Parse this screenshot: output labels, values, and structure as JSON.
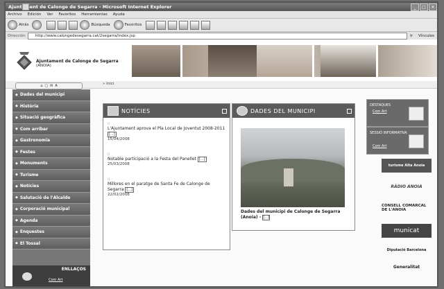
{
  "window": {
    "title": "Ajuntament de Calonge de Segarra - Microsoft Internet Explorer"
  },
  "menu": [
    "Archivo",
    "Edición",
    "Ver",
    "Favoritos",
    "Herramientas",
    "Ayuda"
  ],
  "toolbar": {
    "back": "Atrás",
    "search": "Búsqueda",
    "favorites": "Favoritos"
  },
  "address": {
    "label": "Dirección",
    "url": "http://www.calongedesegarra.cat/2segarra/index.jsp",
    "go": "Ir",
    "links": "Vínculos"
  },
  "site": {
    "name": "Ajuntament de Calonge de Segarra",
    "sub": "(ANOIA)"
  },
  "breadcrumb": "Inici",
  "sidebar": {
    "items": [
      "Dades del municipi",
      "Història",
      "Situació geogràfica",
      "Com arribar",
      "Gastronomia",
      "Festes",
      "Monuments",
      "Turisme",
      "Notícies",
      "Salutació de l'Alcalde",
      "Corporació municipal",
      "Agenda",
      "Enquestes",
      "El Tossal"
    ],
    "enllacos_title": "ENLLAÇOS",
    "enllacos_link": "Com Art"
  },
  "news": {
    "title": "NOTÍCIES",
    "items": [
      {
        "text": "L'Ajuntament aprova el Pla Local de Joventut 2008-2011",
        "more": "[...]",
        "date": "15/04/2008"
      },
      {
        "text": "Notable participació a la Festa del Panellet",
        "more": "[...]",
        "date": "25/03/2008"
      },
      {
        "text": "Millores en el paratge de Santa Fe de Calonge de Segarra",
        "more": "[...]",
        "date": "22/02/2008"
      }
    ]
  },
  "municipi": {
    "title": "DADES DEL MUNICIPI",
    "caption": "Dades del municipi de Calonge de Segarra (Anoia) -",
    "more": "[...]"
  },
  "right": {
    "box1": {
      "title": "DESTAQUES",
      "link": "Com Art"
    },
    "box2": {
      "title": "SESSIÓ INFORMATIVA",
      "link": "Com Art"
    },
    "logos": [
      "turisme Alta Anoia",
      "RÀDIO ANOIA",
      "CONSELL COMARCAL DE L'ANOIA",
      "municat",
      "Diputació Barcelona",
      "Generalitat"
    ]
  }
}
